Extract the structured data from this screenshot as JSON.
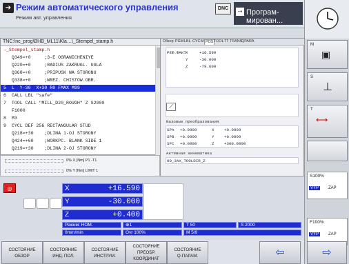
{
  "header": {
    "mode_title": "Режим автоматического управления",
    "mode_sub": "Режим авт. управления",
    "dnc": "DNC",
    "prog_mode": "Програм- мирован..."
  },
  "program": {
    "path": "TNC:\\nc_prog\\BHB_ML11\\Kla…\\_Stempel_stamp.h",
    "lines": [
      "→_Stempel_stamp.h",
      "   Q349=+0     ;3-E OGRANICHENIYE",
      "   Q220=+0     ;RADIUS ZAKRUGL. UGLA",
      "   Q368=+0     ;PRIPUSK NA STORONU",
      "   Q338=+0     ;WREZ. CHISTOW.OBR.",
      "5  L  Y-30  X+30 R0 FMAX M99",
      "6  CALL LBL \"safe\"",
      "7  TOOL CALL \"MILL_D20_ROUGH\" Z S2000",
      "   F1000",
      "8  M3",
      "9  CYCL DEF 256 RECTANGULAR STUD",
      "   Q218=+30    ;DLINA 1-OJ STORONY",
      "   Q424=+60    ;WORKPC. BLANK SIDE 1",
      "   Q219=+30    ;DLINA 2-OJ STORONY"
    ]
  },
  "tabs": [
    "Обзор",
    "PGM",
    "LBL",
    "CYC",
    "M",
    "POS",
    "TOOL",
    "TT",
    "TRANS",
    "QPARA"
  ],
  "pos_table": {
    "label": "РЕФ.ФАКТ",
    "rows": [
      {
        "axis": "X",
        "value": "+16.590"
      },
      {
        "axis": "Y",
        "value": "-30.000"
      },
      {
        "axis": "Z",
        "value": "-79.600"
      }
    ]
  },
  "transforms": {
    "title": "Базовые преобразования",
    "rows": [
      {
        "name": "SPA",
        "v1": "+0.0000",
        "axis": "X",
        "v2": "+0.0000"
      },
      {
        "name": "SPB",
        "v1": "+0.0000",
        "axis": "Y",
        "v2": "+0.0000"
      },
      {
        "name": "SPC",
        "v1": "+0.0000",
        "axis": "Z",
        "v2": "+300.0000"
      }
    ]
  },
  "kinematics": {
    "title": "Активная кинематика",
    "value": "00_3AX_TOOLDIR_Z"
  },
  "bars": {
    "x_label": "0% X [Nm]  P1 -T1",
    "y_label": "0% Y [Nm]  LIMIT 1"
  },
  "axes": [
    {
      "name": "X",
      "value": "+16.590"
    },
    {
      "name": "Y",
      "value": "-30.000"
    },
    {
      "name": "Z",
      "value": "+0.400"
    }
  ],
  "status": {
    "mode": "Режим: НОМ.",
    "tool_icon": "⊕1",
    "t": "T 50",
    "s": "S 2000",
    "feed": "0mm/min",
    "ovr": "Ovr 100%",
    "m": "M 5/9"
  },
  "softkeys": [
    [
      "СОСТОЯНИЕ",
      "ОБЗОР"
    ],
    [
      "СОСТОЯНИЕ",
      "ИНД. ПОЛ."
    ],
    [
      "СОСТОЯНИЕ",
      "ИНСТРУМ."
    ],
    [
      "СОСТОЯНИЕ",
      "ПРЕОБР.",
      "КООРДИНАТ"
    ],
    [
      "СОСТОЯНИЕ",
      "Q-ПАРАМ."
    ]
  ],
  "right": {
    "s_ovr": "S100%",
    "f_ovr": "F100%",
    "vyp": "VYP",
    "zap": "ZAP"
  },
  "colors": {
    "accent": "#1e2cd0",
    "title": "#2a35c8",
    "spindle": "#e02020"
  }
}
